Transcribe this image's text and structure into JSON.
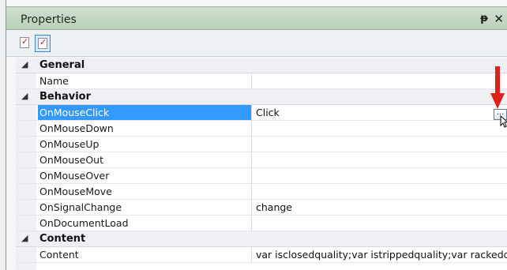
{
  "panel": {
    "title": "Properties"
  },
  "titlebar": {
    "pin_glyph": "ᵽ",
    "close_glyph": "✕"
  },
  "toolbar": {
    "buttons": [
      {
        "icon": "categorized-icon",
        "active": false
      },
      {
        "icon": "events-icon",
        "active": true
      }
    ]
  },
  "categories": {
    "general": {
      "label": "General",
      "expander": "◢"
    },
    "behavior": {
      "label": "Behavior",
      "expander": "◢"
    },
    "content": {
      "label": "Content",
      "expander": "◢"
    }
  },
  "properties": {
    "name": {
      "label": "Name",
      "value": ""
    },
    "onmouseclick": {
      "label": "OnMouseClick",
      "value": "Click"
    },
    "onmousedown": {
      "label": "OnMouseDown",
      "value": ""
    },
    "onmouseup": {
      "label": "OnMouseUp",
      "value": ""
    },
    "onmouseout": {
      "label": "OnMouseOut",
      "value": ""
    },
    "onmouseover": {
      "label": "OnMouseOver",
      "value": ""
    },
    "onmousemove": {
      "label": "OnMouseMove",
      "value": ""
    },
    "onsignalchange": {
      "label": "OnSignalChange",
      "value": "change"
    },
    "ondocumentload": {
      "label": "OnDocumentLoad",
      "value": ""
    },
    "content": {
      "label": "Content",
      "value": "var isclosedquality;var istrippedquality;var rackedqu"
    }
  },
  "ellipsis": {
    "label": "..."
  },
  "colors": {
    "selection": "#3399ff",
    "titlebar": "#c4d9c4",
    "arrow": "#e0201a"
  }
}
